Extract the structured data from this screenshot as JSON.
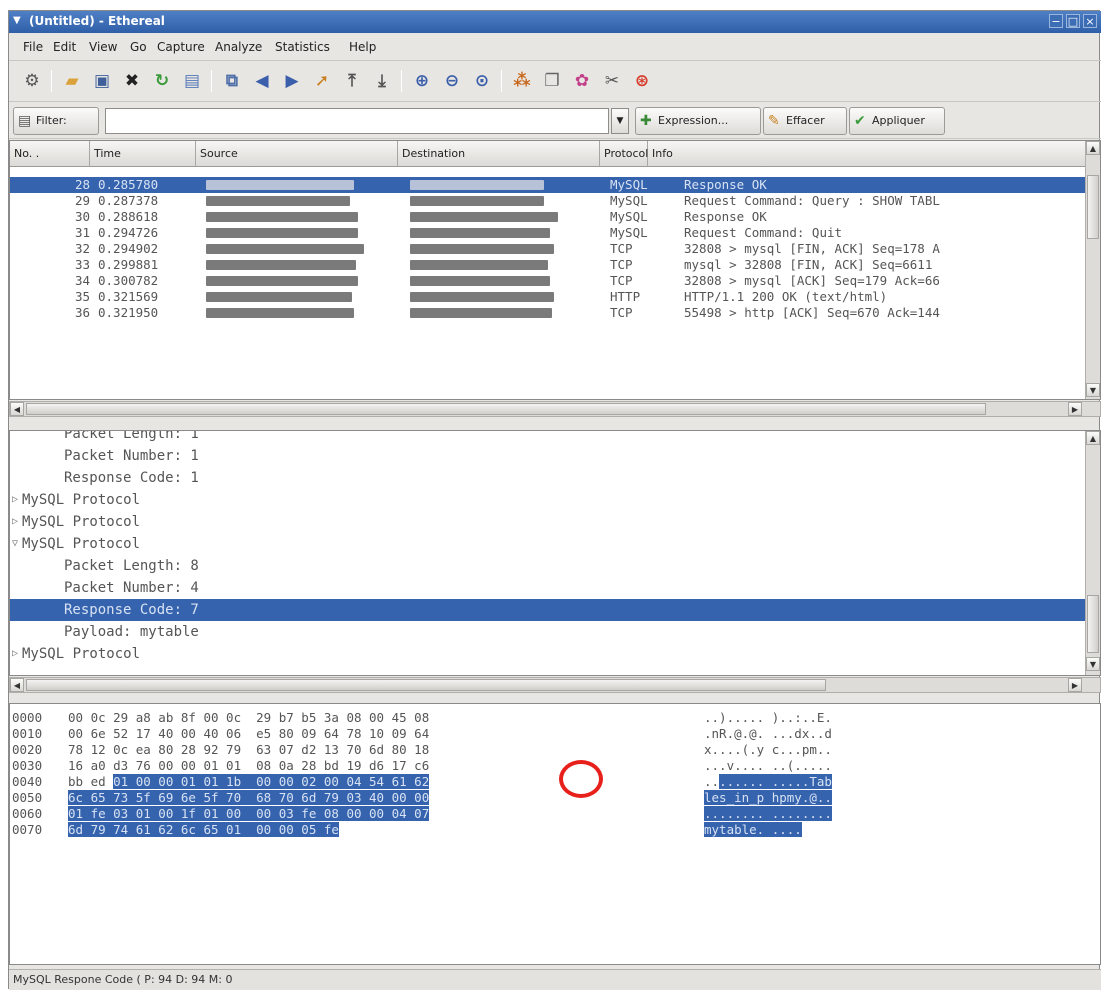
{
  "window": {
    "title": "(Untitled) - Ethereal",
    "controls": [
      "−",
      "□",
      "×"
    ]
  },
  "menu": [
    "File",
    "Edit",
    "View",
    "Go",
    "Capture",
    "Analyze",
    "Statistics",
    "Help"
  ],
  "filter": {
    "label": "Filter:",
    "value": "",
    "expression_label": "Expression...",
    "clear_label": "Effacer",
    "apply_label": "Appliquer"
  },
  "packet_list": {
    "columns": [
      "No. .",
      "Time",
      "Source",
      "Destination",
      "Protocol",
      "Info"
    ],
    "rows": [
      {
        "no": "28",
        "time": "0.285780",
        "protocol": "MySQL",
        "info": "Response OK"
      },
      {
        "no": "29",
        "time": "0.287378",
        "protocol": "MySQL",
        "info": "Request Command: Query : SHOW TABL"
      },
      {
        "no": "30",
        "time": "0.288618",
        "protocol": "MySQL",
        "info": "Response OK"
      },
      {
        "no": "31",
        "time": "0.294726",
        "protocol": "MySQL",
        "info": "Request Command: Quit"
      },
      {
        "no": "32",
        "time": "0.294902",
        "protocol": "TCP",
        "info": "32808 > mysql [FIN, ACK] Seq=178 A"
      },
      {
        "no": "33",
        "time": "0.299881",
        "protocol": "TCP",
        "info": "mysql > 32808 [FIN, ACK] Seq=6611"
      },
      {
        "no": "34",
        "time": "0.300782",
        "protocol": "TCP",
        "info": "32808 > mysql [ACK] Seq=179 Ack=66"
      },
      {
        "no": "35",
        "time": "0.321569",
        "protocol": "HTTP",
        "info": "HTTP/1.1 200 OK (text/html)"
      },
      {
        "no": "36",
        "time": "0.321950",
        "protocol": "TCP",
        "info": "55498 > http [ACK] Seq=670 Ack=144"
      }
    ],
    "selected_index": 0
  },
  "detail_tree": [
    {
      "text": "Packet Length: 1",
      "indent": 2,
      "selected": false,
      "expander": ""
    },
    {
      "text": "Packet Number: 1",
      "indent": 2,
      "selected": false,
      "expander": ""
    },
    {
      "text": "Response Code: 1",
      "indent": 2,
      "selected": false,
      "expander": ""
    },
    {
      "text": "MySQL Protocol",
      "indent": 0,
      "selected": false,
      "expander": "▷"
    },
    {
      "text": "MySQL Protocol",
      "indent": 0,
      "selected": false,
      "expander": "▷"
    },
    {
      "text": "MySQL Protocol",
      "indent": 0,
      "selected": false,
      "expander": "▽"
    },
    {
      "text": "Packet Length: 8",
      "indent": 2,
      "selected": false,
      "expander": ""
    },
    {
      "text": "Packet Number: 4",
      "indent": 2,
      "selected": false,
      "expander": ""
    },
    {
      "text": "Response Code: 7",
      "indent": 2,
      "selected": true,
      "expander": ""
    },
    {
      "text": "Payload: mytable",
      "indent": 2,
      "selected": false,
      "expander": ""
    },
    {
      "text": "MySQL Protocol",
      "indent": 0,
      "selected": false,
      "expander": "▷"
    }
  ],
  "hex_dump": [
    {
      "offset": "0000",
      "pre": "00 0c 29 a8 ab 8f 00 0c  29 b7 b5 3a 08 00 45 08",
      "hl": "",
      "post": "",
      "ascii_pre": "..)..... )..:..E.",
      "ascii_hl": ""
    },
    {
      "offset": "0010",
      "pre": "00 6e 52 17 40 00 40 06  e5 80 09 64 78 10 09 64",
      "hl": "",
      "post": "",
      "ascii_pre": ".nR.@.@. ...dx..d",
      "ascii_hl": ""
    },
    {
      "offset": "0020",
      "pre": "78 12 0c ea 80 28 92 79  63 07 d2 13 70 6d 80 18",
      "hl": "",
      "post": "",
      "ascii_pre": "x....(.y c...pm..",
      "ascii_hl": ""
    },
    {
      "offset": "0030",
      "pre": "16 a0 d3 76 00 00 01 01  08 0a 28 bd 19 d6 17 c6",
      "hl": "",
      "post": "",
      "ascii_pre": "...v.... ..(.....",
      "ascii_hl": ""
    },
    {
      "offset": "0040",
      "pre": "bb ed ",
      "hl": "01 00 00 01 01 1b  00 00 02 00 04 54 61 62",
      "post": "",
      "ascii_pre": "..",
      "ascii_hl": "...... .....Tab"
    },
    {
      "offset": "0050",
      "pre": "",
      "hl": "6c 65 73 5f 69 6e 5f 70  68 70 6d 79 03 40 00 00",
      "post": "",
      "ascii_pre": "",
      "ascii_hl": "les_in_p hpmy.@.."
    },
    {
      "offset": "0060",
      "pre": "",
      "hl": "01 fe 03 01 00 1f 01 00  00 03 fe 08 00 00 04 07",
      "post": "",
      "ascii_pre": "",
      "ascii_hl": "........ ........"
    },
    {
      "offset": "0070",
      "pre": "",
      "hl": "6d 79 74 61 62 6c 65 01  00 00 05 fe",
      "post": "",
      "ascii_pre": "",
      "ascii_hl": "mytable. ...."
    }
  ],
  "status": "MySQL Respone Code (  P: 94 D: 94 M: 0",
  "toolbar_icons": [
    "interfaces-icon",
    "open-icon",
    "save-icon",
    "close-icon",
    "reload-icon",
    "print-icon",
    "find-icon",
    "back-icon",
    "forward-icon",
    "goto-icon",
    "first-icon",
    "last-icon",
    "zoom-in-icon",
    "zoom-out-icon",
    "zoom-normal-icon",
    "capture-filter-icon",
    "display-filter-icon",
    "coloring-icon",
    "preferences-icon",
    "help-icon"
  ],
  "colors": {
    "selection": "#3563ad",
    "title_bar": "#2e5fa8",
    "annotation_circle": "#e8201b"
  }
}
